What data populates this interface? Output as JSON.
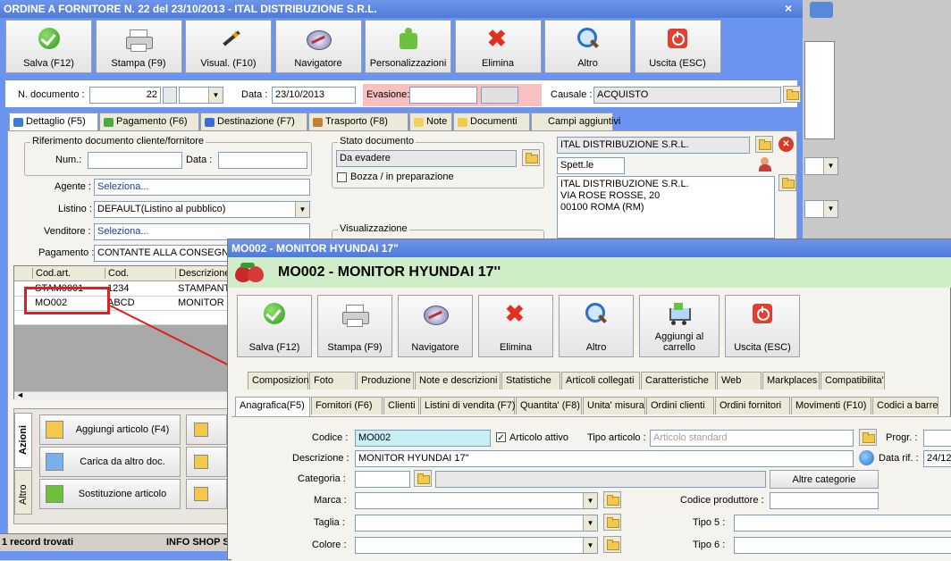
{
  "main_window": {
    "title": "ORDINE A FORNITORE N. 22 del 23/10/2013 - ITAL DISTRIBUZIONE S.R.L.",
    "close_glyph": "×",
    "toolbar": [
      {
        "label": "Salva (F12)",
        "icon": "check-icon"
      },
      {
        "label": "Stampa (F9)",
        "icon": "printer-icon"
      },
      {
        "label": "Visual. (F10)",
        "icon": "magic-wand-icon"
      },
      {
        "label": "Navigatore",
        "icon": "compass-icon"
      },
      {
        "label": "Personalizzazioni",
        "icon": "puzzle-icon"
      },
      {
        "label": "Elimina",
        "icon": "delete-x-icon"
      },
      {
        "label": "Altro",
        "icon": "magnifier-icon"
      },
      {
        "label": "Uscita (ESC)",
        "icon": "power-icon"
      }
    ],
    "header": {
      "n_documento_label": "N. documento :",
      "n_documento_value": "22",
      "data_label": "Data :",
      "data_value": "23/10/2013",
      "evasione_label": "Evasione:",
      "causale_label": "Causale :",
      "causale_value": "ACQUISTO"
    },
    "tabs": [
      "Dettaglio (F5)",
      "Pagamento (F6)",
      "Destinazione (F7)",
      "Trasporto (F8)",
      "Note",
      "Documenti",
      "Campi aggiuntivi"
    ],
    "riferimento": {
      "title": "Riferimento documento cliente/fornitore",
      "num_label": "Num.:",
      "data_label": "Data :"
    },
    "agente_label": "Agente :",
    "agente_value": "Seleziona...",
    "listino_label": "Listino :",
    "listino_value": "DEFAULT(Listino al pubblico)",
    "venditore_label": "Venditore :",
    "venditore_value": "Seleziona...",
    "pagamento_label": "Pagamento :",
    "pagamento_value": "CONTANTE ALLA CONSEGNA",
    "stato": {
      "title": "Stato documento",
      "value": "Da evadere",
      "bozza_label": "Bozza / in preparazione"
    },
    "visualizzazione_title": "Visualizzazione",
    "cliente": {
      "name": "ITAL DISTRIBUZIONE S.R.L.",
      "spett": "Spett.le",
      "address_lines": [
        "ITAL DISTRIBUZIONE S.R.L.",
        "VIA ROSE ROSSE, 20",
        "00100 ROMA (RM)"
      ]
    },
    "grid": {
      "columns": [
        "Cod.art.",
        "Cod.",
        "Descrizione"
      ],
      "rows": [
        [
          "STAM0001",
          "1234",
          "STAMPANTE"
        ],
        [
          "MO002",
          "ABCD",
          "MONITOR H"
        ]
      ]
    },
    "side_tabs": [
      "Azioni",
      "Altro"
    ],
    "actions": [
      {
        "label": "Aggiungi articolo (F4)",
        "icon": "add-box-icon"
      },
      {
        "label": "Carica da altro doc.",
        "icon": "load-doc-icon"
      },
      {
        "label": "Sostituzione articolo",
        "icon": "replace-icon"
      }
    ],
    "status_bar": {
      "records": "1 record trovati",
      "info": "INFO SHOP S"
    }
  },
  "article_window": {
    "title": "MO002 - MONITOR HYUNDAI 17\"",
    "header_title": "MO002 - MONITOR HYUNDAI 17''",
    "toolbar": [
      {
        "label": "Salva (F12)",
        "icon": "check-icon"
      },
      {
        "label": "Stampa (F9)",
        "icon": "printer-icon"
      },
      {
        "label": "Navigatore",
        "icon": "compass-icon"
      },
      {
        "label": "Elimina",
        "icon": "delete-x-icon"
      },
      {
        "label": "Altro",
        "icon": "magnifier-icon"
      },
      {
        "label": "Aggiungi al carrello",
        "icon": "cart-icon"
      },
      {
        "label": "Uscita (ESC)",
        "icon": "power-icon"
      }
    ],
    "tabs_row1": [
      "Composizioni",
      "Foto",
      "Produzione",
      "Note e descrizioni",
      "Statistiche",
      "Articoli collegati",
      "Caratteristiche",
      "Web",
      "Markplaces",
      "Compatibilita'"
    ],
    "tabs_row2": [
      "Anagrafica(F5)",
      "Fornitori (F6)",
      "Clienti",
      "Listini di vendita (F7)",
      "Quantita' (F8)",
      "Unita' misura",
      "Ordini clienti",
      "Ordini fornitori",
      "Movimenti (F10)",
      "Codici a barre"
    ],
    "form": {
      "codice_label": "Codice :",
      "codice_value": "MO002",
      "articolo_attivo_label": "Articolo attivo",
      "tipo_articolo_label": "Tipo articolo :",
      "tipo_articolo_placeholder": "Articolo standard",
      "progr_label": "Progr. :",
      "descrizione_label": "Descrizione :",
      "descrizione_value": "MONITOR HYUNDAI 17\"",
      "data_rif_label": "Data rif. :",
      "data_rif_value": "24/12",
      "categoria_label": "Categoria :",
      "altre_categorie_label": "Altre categorie",
      "marca_label": "Marca :",
      "codice_produttore_label": "Codice produttore :",
      "taglia_label": "Taglia :",
      "tipo5_label": "Tipo 5 :",
      "colore_label": "Colore :",
      "tipo6_label": "Tipo 6 :"
    }
  },
  "colors": {
    "title_blue": "#3a6fd8",
    "window_blue": "#6b93f0",
    "article_green": "#cfeec7",
    "highlight_red": "#e02020"
  }
}
